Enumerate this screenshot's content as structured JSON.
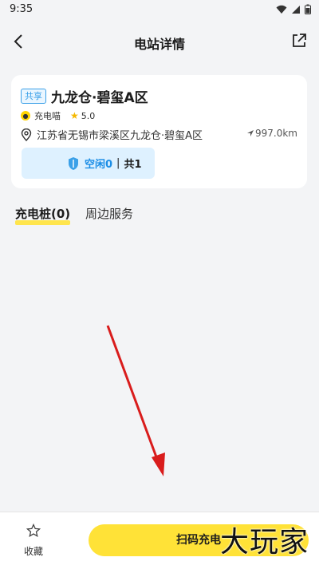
{
  "status_bar": {
    "time": "9:35"
  },
  "header": {
    "title": "电站详情"
  },
  "station": {
    "tag": "共享",
    "name": "九龙仓·碧玺A区",
    "operator": "充电喵",
    "rating": "5.0",
    "address": "江苏省无锡市梁溪区九龙仓·碧玺A区",
    "distance": "997.0km",
    "availability": {
      "free": "空闲0",
      "separator": "|",
      "total": "共1"
    }
  },
  "tabs": [
    {
      "label": "充电桩(0)",
      "active": true
    },
    {
      "label": "周边服务",
      "active": false
    }
  ],
  "bottom_bar": {
    "favorite_label": "收藏",
    "scan_label": "扫码充电"
  },
  "watermark": "大玩家",
  "colors": {
    "accent_yellow": "#ffe237",
    "tag_blue": "#3aa0e8",
    "annotation_arrow": "#d91c1c"
  }
}
